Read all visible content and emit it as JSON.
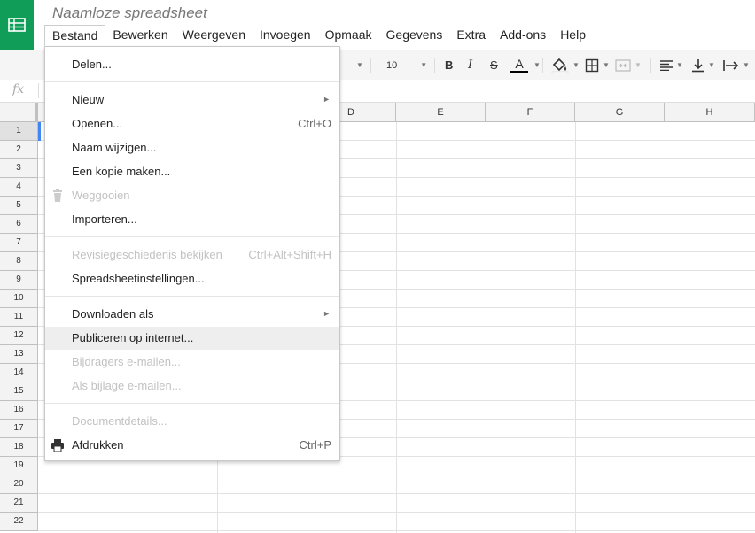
{
  "doc": {
    "title": "Naamloze spreadsheet"
  },
  "menubar": [
    "Bestand",
    "Bewerken",
    "Weergeven",
    "Invoegen",
    "Opmaak",
    "Gegevens",
    "Extra",
    "Add-ons",
    "Help"
  ],
  "toolbar": {
    "font_size": "10",
    "bold": "B",
    "italic": "I",
    "strike": "S",
    "text_color": "A"
  },
  "formula": {
    "fx": "fx"
  },
  "columns": [
    "D",
    "E",
    "F",
    "G",
    "H"
  ],
  "rows": [
    "1",
    "2",
    "3",
    "4",
    "5",
    "6",
    "7",
    "8",
    "9",
    "10",
    "11",
    "12",
    "13",
    "14",
    "15",
    "16",
    "17",
    "18",
    "19",
    "20",
    "21",
    "22"
  ],
  "file_menu": {
    "share": "Delen...",
    "new": "Nieuw",
    "open": "Openen...",
    "open_shortcut": "Ctrl+O",
    "rename": "Naam wijzigen...",
    "copy": "Een kopie maken...",
    "trash": "Weggooien",
    "import": "Importeren...",
    "revisions": "Revisiegeschiedenis bekijken",
    "revisions_shortcut": "Ctrl+Alt+Shift+H",
    "settings": "Spreadsheetinstellingen...",
    "download": "Downloaden als",
    "publish": "Publiceren op internet...",
    "email_collab": "Bijdragers e-mailen...",
    "email_attach": "Als bijlage e-mailen...",
    "details": "Documentdetails...",
    "print": "Afdrukken",
    "print_shortcut": "Ctrl+P"
  },
  "colors": {
    "brand": "#0f9d58",
    "hover": "#eeeeee",
    "disabled": "#c2c2c2"
  }
}
